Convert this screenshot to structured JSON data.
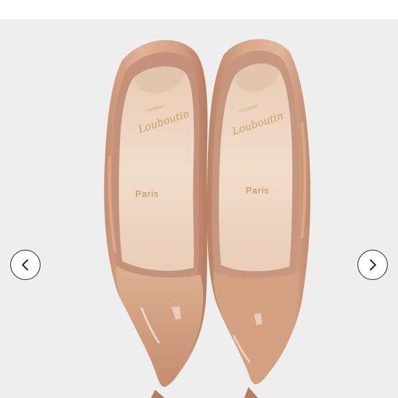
{
  "product_image": {
    "brand_signature": "Christian Louboutin",
    "brand_small_left": "Christian",
    "brand_script_left": "Louboutin",
    "brand_small_right": "Christian",
    "brand_script_right": "Louboutin",
    "insole_text_left": "Paris",
    "insole_text_right": "Paris",
    "colors": {
      "backdrop": "#eeeeef",
      "patent_nude": "#d9a88a",
      "patent_shadow": "#b9826a",
      "insole": "#efd6c4",
      "gold_foil": "#c9a064"
    }
  },
  "carousel": {
    "prev_icon": "chevron-left-icon",
    "next_icon": "chevron-right-icon"
  }
}
